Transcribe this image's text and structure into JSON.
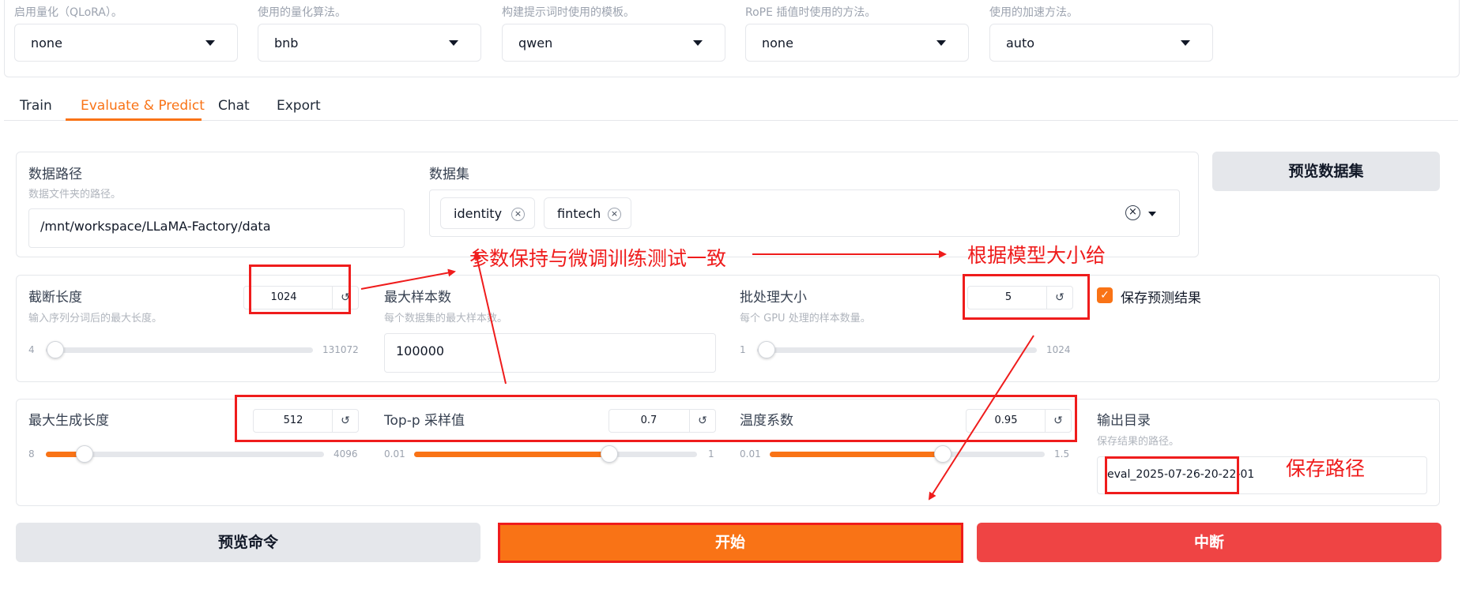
{
  "top_selects": [
    {
      "desc": "启用量化（QLoRA）。",
      "value": "none"
    },
    {
      "desc": "使用的量化算法。",
      "value": "bnb"
    },
    {
      "desc": "构建提示词时使用的模板。",
      "value": "qwen"
    },
    {
      "desc": "RoPE 插值时使用的方法。",
      "value": "none"
    },
    {
      "desc": "使用的加速方法。",
      "value": "auto"
    }
  ],
  "tabs": [
    "Train",
    "Evaluate & Predict",
    "Chat",
    "Export"
  ],
  "active_tab": "Evaluate & Predict",
  "colors": {
    "accent": "#f97316",
    "stop": "#ef4444",
    "annotation": "#ef1c1c"
  },
  "data_section": {
    "path_label": "数据路径",
    "path_desc": "数据文件夹的路径。",
    "path_value": "/mnt/workspace/LLaMA-Factory/data",
    "dataset_label": "数据集",
    "datasets": [
      "identity",
      "fintech"
    ],
    "preview_button": "预览数据集"
  },
  "params": {
    "cutoff": {
      "label": "截断长度",
      "desc": "输入序列分词后的最大长度。",
      "value": "1024",
      "min": "4",
      "max": "131072"
    },
    "max_samples": {
      "label": "最大样本数",
      "desc": "每个数据集的最大样本数。",
      "value": "100000"
    },
    "batch": {
      "label": "批处理大小",
      "desc": "每个 GPU 处理的样本数量。",
      "value": "5",
      "min": "1",
      "max": "1024"
    },
    "save_predict": {
      "label": "保存预测结果",
      "checked": true
    },
    "max_new_tokens": {
      "label": "最大生成长度",
      "value": "512",
      "min": "8",
      "max": "4096"
    },
    "top_p": {
      "label": "Top-p 采样值",
      "value": "0.7",
      "min": "0.01",
      "max": "1"
    },
    "temperature": {
      "label": "温度系数",
      "value": "0.95",
      "min": "0.01",
      "max": "1.5"
    },
    "output_dir": {
      "label": "输出目录",
      "desc": "保存结果的路径。",
      "value": "eval_2025-07-26-20-22-01"
    }
  },
  "buttons": {
    "preview_cmd": "预览命令",
    "start": "开始",
    "stop": "中断"
  },
  "annotations": {
    "consistent": "参数保持与微调训练测试一致",
    "by_model": "根据模型大小给",
    "save_path": "保存路径"
  },
  "icons": {
    "reset": "↺",
    "clear": "×",
    "check": "✓"
  }
}
